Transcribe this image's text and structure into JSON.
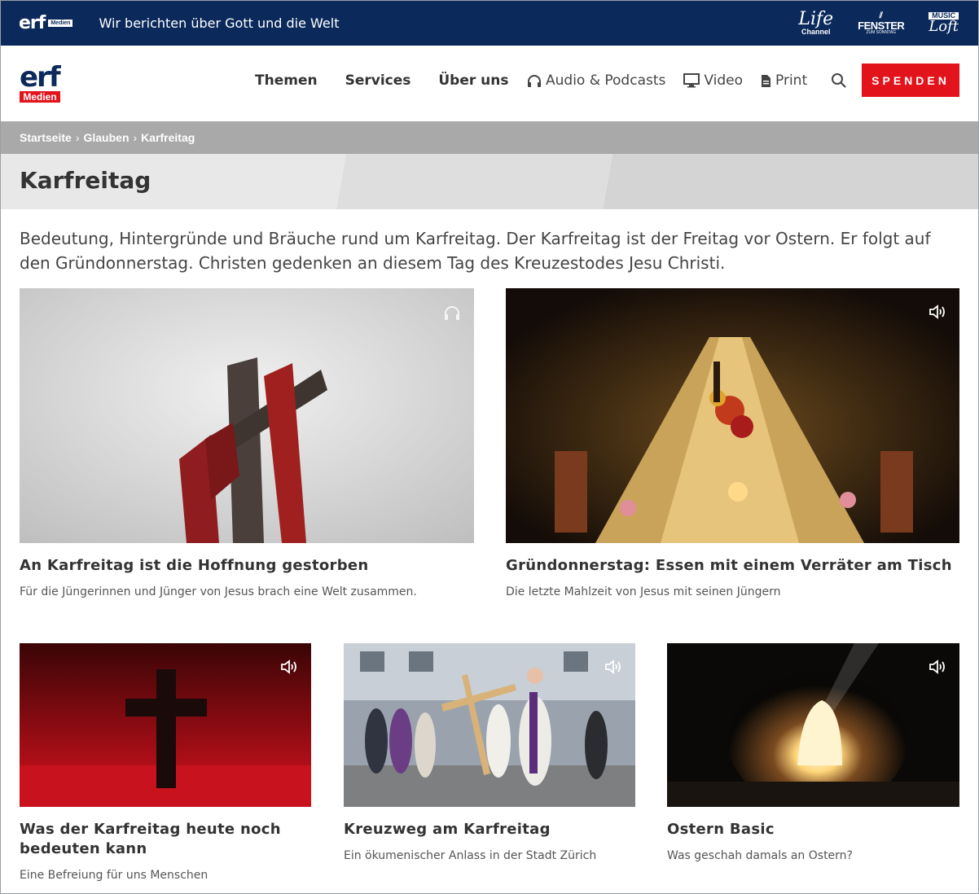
{
  "topbar": {
    "logo_text": "erf",
    "logo_badge": "Medien",
    "slogan": "Wir berichten über Gott und die Welt",
    "brands": [
      {
        "line1": "Life",
        "line2": "Channel"
      },
      {
        "line1": "FENSTER",
        "line2": "ZUM SONNTAG"
      },
      {
        "line1": "MUSIC",
        "line2": "Loft"
      }
    ]
  },
  "header": {
    "logo_text": "erf",
    "logo_badge": "Medien",
    "nav": [
      "Themen",
      "Services",
      "Über uns"
    ],
    "media_nav": {
      "audio": "Audio & Podcasts",
      "video": "Video",
      "print": "Print"
    },
    "donate_label": "SPENDEN"
  },
  "breadcrumb": [
    "Startseite",
    "Glauben",
    "Karfreitag"
  ],
  "breadcrumb_separator": "›",
  "page": {
    "title": "Karfreitag",
    "intro": "Bedeutung, Hintergründe und Bräuche rund um Karfreitag. Der Karfreitag ist der Freitag vor Ostern. Er folgt auf den Gründonnerstag. Christen gedenken an diesem Tag des Kreuzestodes Jesu Christi."
  },
  "cards": [
    {
      "title": "An Karfreitag ist die Hoffnung gestorben",
      "teaser": "Für die Jüngerinnen und Jünger von Jesus brach eine Welt zusammen.",
      "media_icon": "headphones-icon"
    },
    {
      "title": "Gründonnerstag: Essen mit einem Verräter am Tisch",
      "teaser": "Die letzte Mahlzeit von Jesus mit seinen Jüngern",
      "media_icon": "speaker-icon"
    },
    {
      "title": "Was der Karfreitag heute noch bedeuten kann",
      "teaser": "Eine Befreiung für uns Menschen",
      "media_icon": "speaker-icon"
    },
    {
      "title": "Kreuzweg am Karfreitag",
      "teaser": "Ein ökumenischer Anlass in der Stadt Zürich",
      "media_icon": "speaker-icon"
    },
    {
      "title": "Ostern Basic",
      "teaser": "Was geschah damals an Ostern?",
      "media_icon": "speaker-icon"
    }
  ],
  "colors": {
    "navy": "#0b2a5b",
    "red": "#e3131b",
    "breadcrumb_bg": "#a9a9a9"
  }
}
